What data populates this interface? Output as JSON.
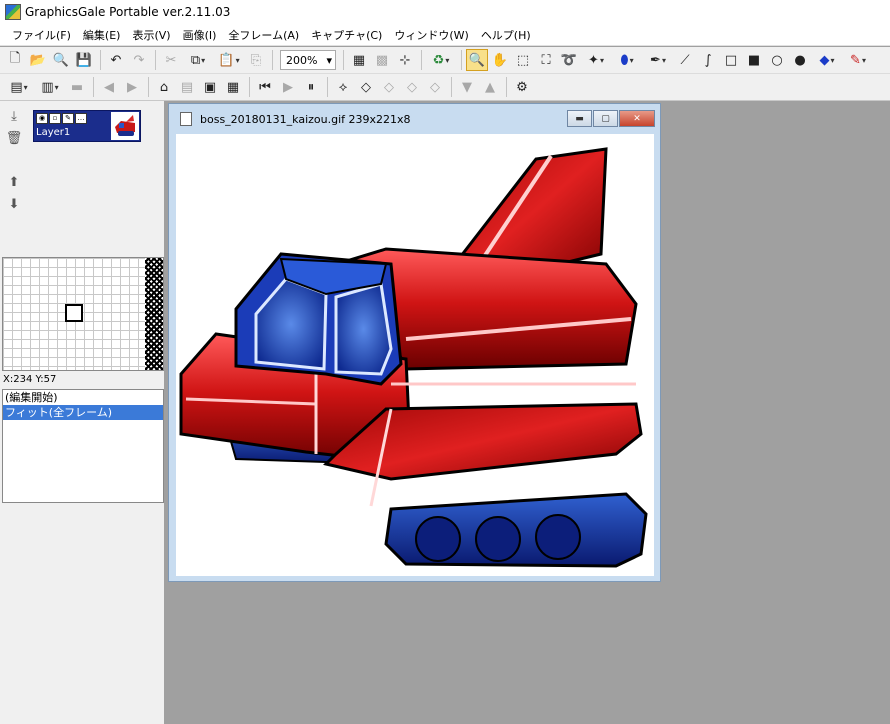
{
  "app": {
    "title": "GraphicsGale Portable ver.2.11.03",
    "icon": "graphicsgale-icon"
  },
  "menu": [
    "ファイル(F)",
    "編集(E)",
    "表示(V)",
    "画像(I)",
    "全フレーム(A)",
    "キャプチャ(C)",
    "ウィンドウ(W)",
    "ヘルプ(H)"
  ],
  "toolbar1": {
    "zoom": "200%"
  },
  "layers": {
    "items": [
      {
        "name": "Layer1"
      }
    ]
  },
  "status": {
    "coords": "X:234 Y:57"
  },
  "history": {
    "items": [
      "(編集開始)",
      "フィット(全フレーム)"
    ]
  },
  "document": {
    "title": "boss_20180131_kaizou.gif 239x221x8"
  },
  "colors": {
    "layer_selected": "#1b2d8c",
    "history_selected": "#3b7ad8",
    "workspace": "#a0a0a0",
    "tool_selected": "#f8e08a"
  }
}
